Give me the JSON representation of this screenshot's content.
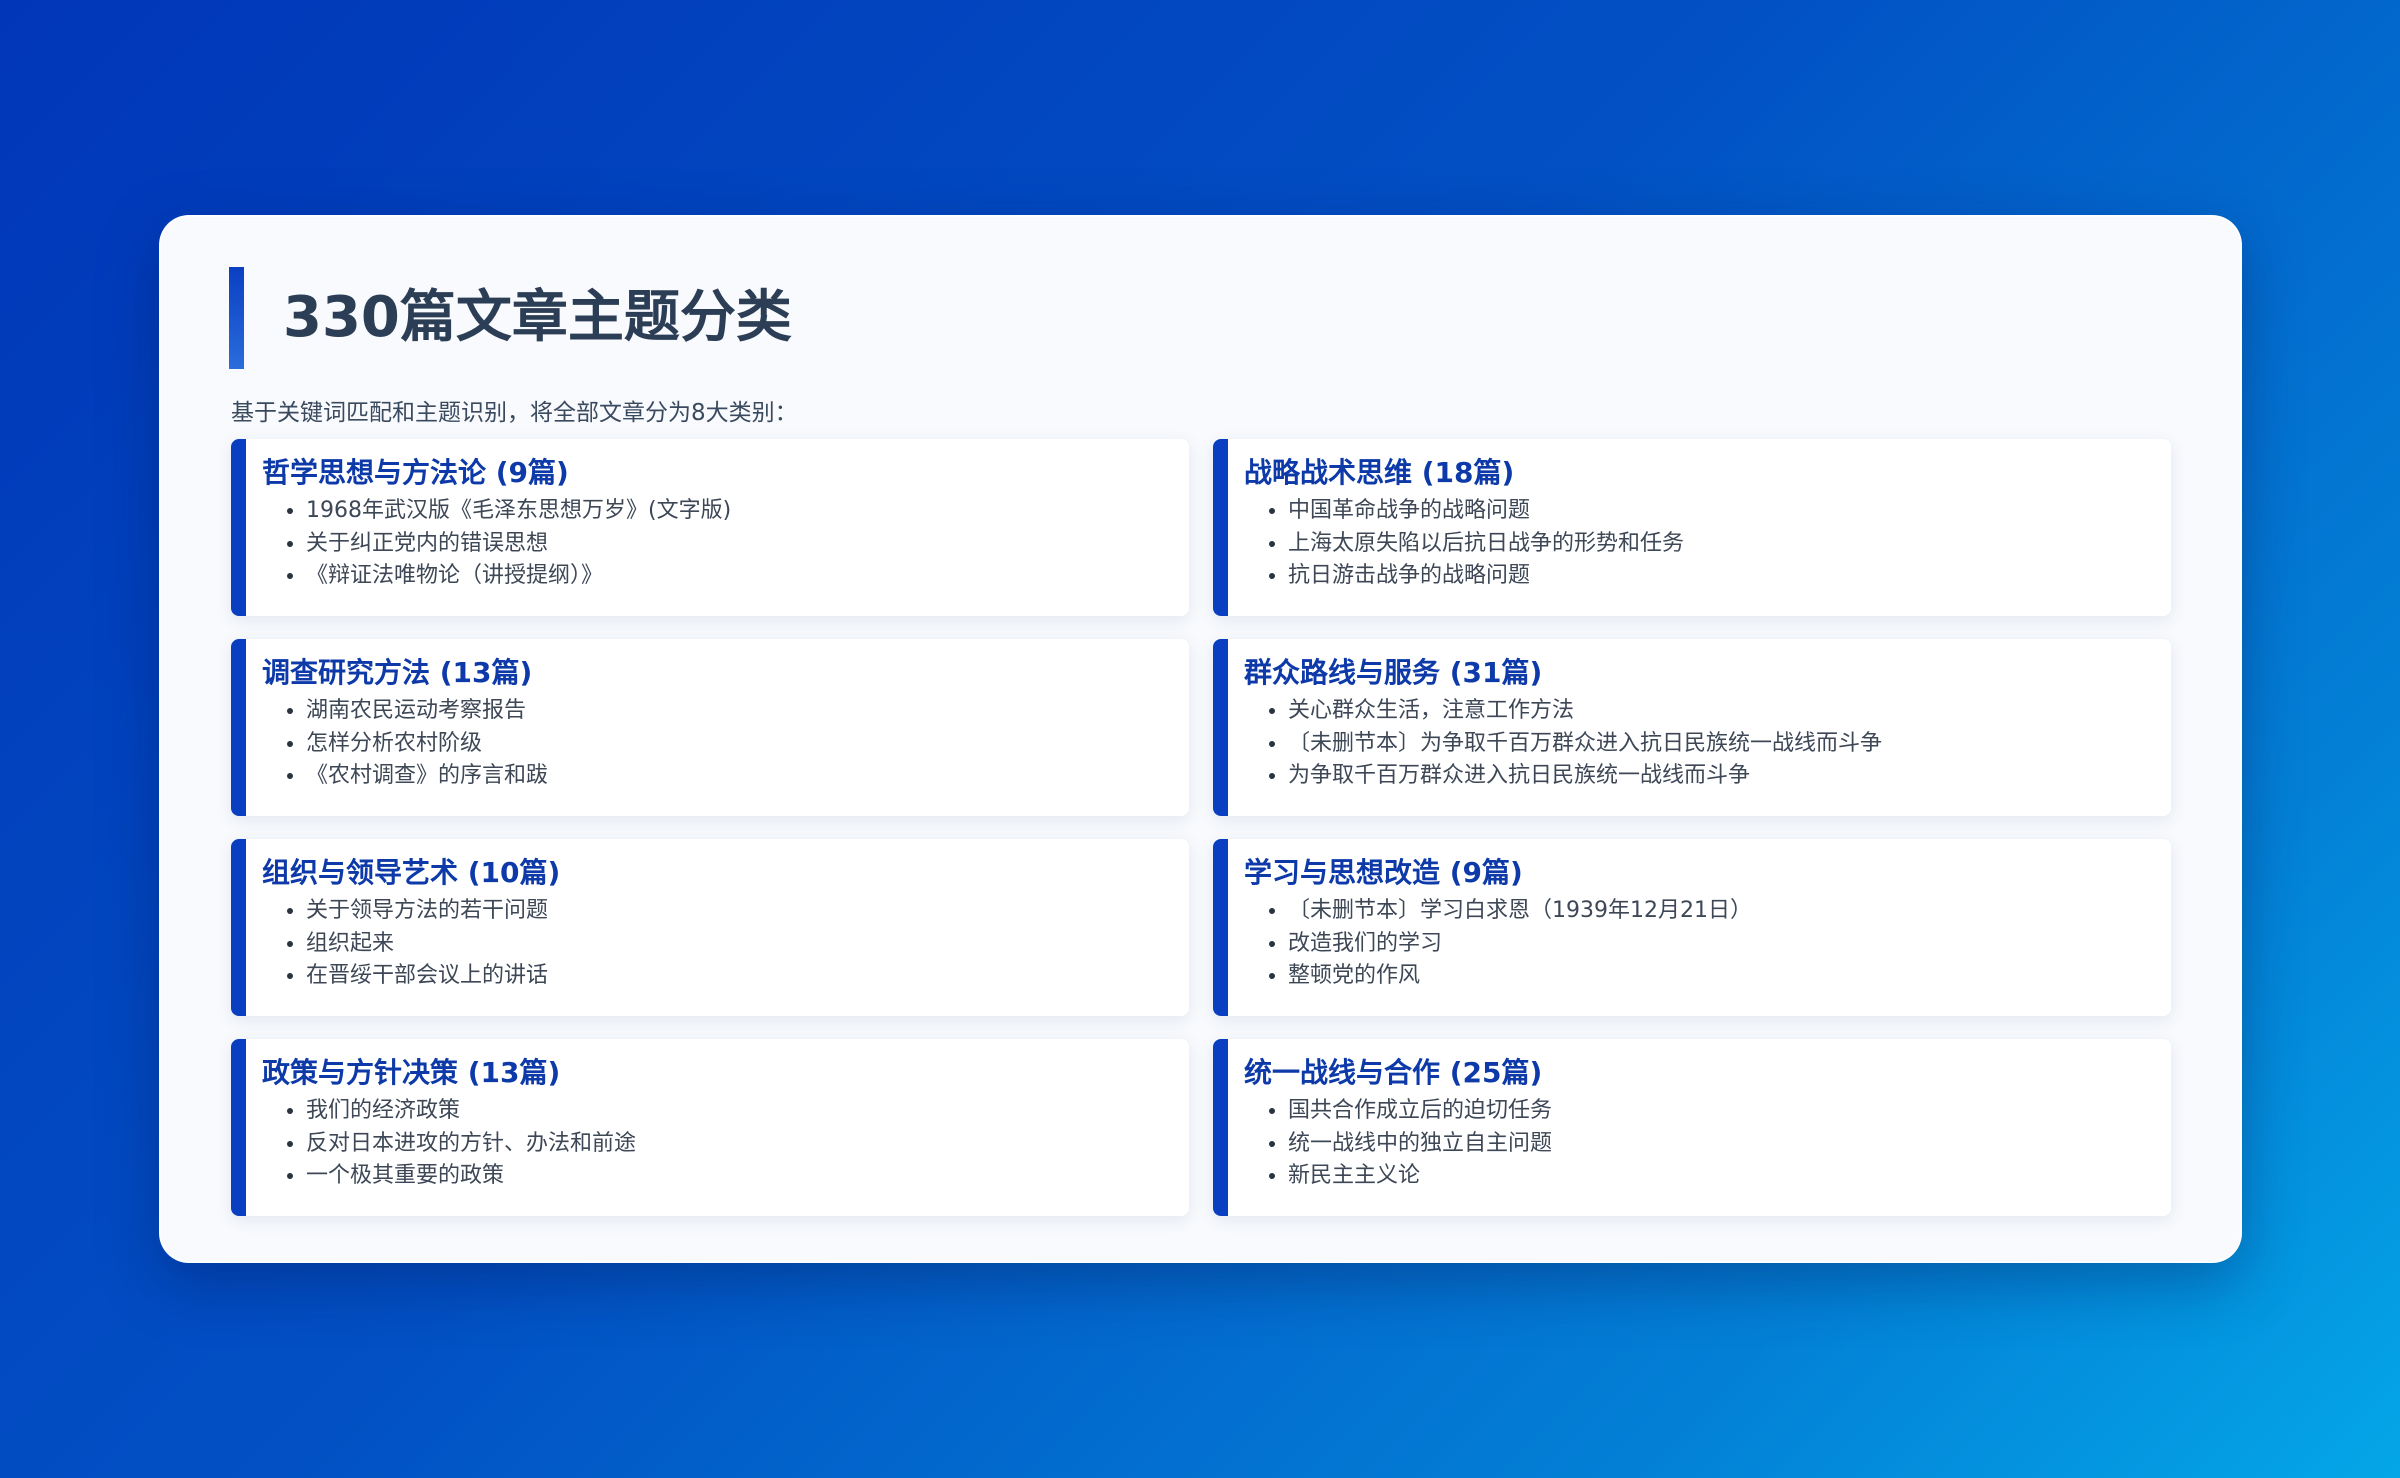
{
  "page": {
    "title": "330篇文章主题分类",
    "subtitle": "基于关键词匹配和主题识别，将全部文章分为8大类别："
  },
  "colors": {
    "accent": "#0a3fc2",
    "category_title": "#0d3aa8",
    "title_text": "#2c3e56"
  },
  "categories": [
    {
      "title": "哲学思想与方法论 (9篇)",
      "items": [
        "1968年武汉版《毛泽东思想万岁》(文字版)",
        "关于纠正党内的错误思想",
        "《辩证法唯物论（讲授提纲）》"
      ]
    },
    {
      "title": "战略战术思维 (18篇)",
      "items": [
        "中国革命战争的战略问题",
        "上海太原失陷以后抗日战争的形势和任务",
        "抗日游击战争的战略问题"
      ]
    },
    {
      "title": "调查研究方法 (13篇)",
      "items": [
        "湖南农民运动考察报告",
        "怎样分析农村阶级",
        "《农村调查》的序言和跋"
      ]
    },
    {
      "title": "群众路线与服务 (31篇)",
      "items": [
        "关心群众生活，注意工作方法",
        "〔未删节本〕为争取千百万群众进入抗日民族统一战线而斗争",
        "为争取千百万群众进入抗日民族统一战线而斗争"
      ]
    },
    {
      "title": "组织与领导艺术 (10篇)",
      "items": [
        "关于领导方法的若干问题",
        "组织起来",
        "在晋绥干部会议上的讲话"
      ]
    },
    {
      "title": "学习与思想改造 (9篇)",
      "items": [
        "〔未删节本〕学习白求恩（1939年12月21日）",
        "改造我们的学习",
        "整顿党的作风"
      ]
    },
    {
      "title": "政策与方针决策 (13篇)",
      "items": [
        "我们的经济政策",
        "反对日本进攻的方针、办法和前途",
        "一个极其重要的政策"
      ]
    },
    {
      "title": "统一战线与合作 (25篇)",
      "items": [
        "国共合作成立后的迫切任务",
        "统一战线中的独立自主问题",
        "新民主主义论"
      ]
    }
  ]
}
